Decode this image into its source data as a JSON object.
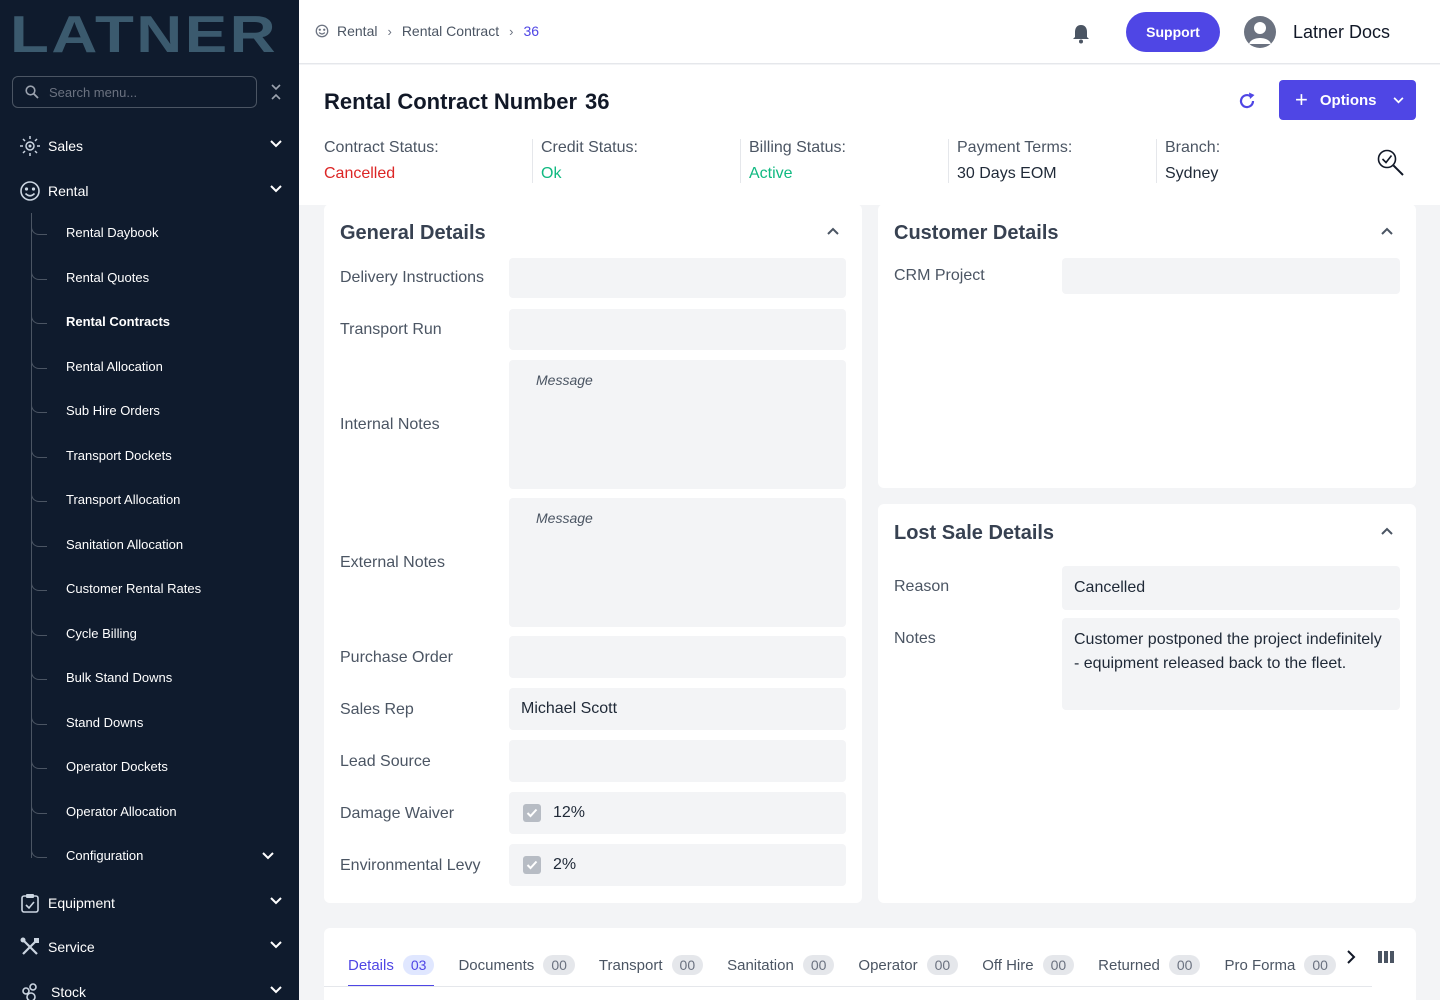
{
  "brand": {
    "logo_text": "LATNER"
  },
  "search": {
    "placeholder": "Search menu..."
  },
  "sidebar": {
    "top_items": [
      {
        "label": "Sales",
        "icon": "sales-icon"
      },
      {
        "label": "Rental",
        "icon": "rental-icon"
      },
      {
        "label": "Equipment",
        "icon": "equipment-icon"
      },
      {
        "label": "Service",
        "icon": "service-icon"
      },
      {
        "label": "Stock",
        "icon": "stock-icon"
      }
    ],
    "rental_sub_items": [
      "Rental Daybook",
      "Rental Quotes",
      "Rental Contracts",
      "Rental Allocation",
      "Sub Hire Orders",
      "Transport Dockets",
      "Transport Allocation",
      "Sanitation Allocation",
      "Customer Rental Rates",
      "Cycle Billing",
      "Bulk Stand Downs",
      "Stand Downs",
      "Operator Dockets",
      "Operator Allocation",
      "Configuration"
    ],
    "active_sub_item": "Rental Contracts"
  },
  "breadcrumb": [
    "Rental",
    "Rental Contract",
    "36"
  ],
  "topbar": {
    "support_label": "Support",
    "user_name": "Latner Docs"
  },
  "header": {
    "title_label": "Rental Contract Number",
    "title_number": "36",
    "options_label": "Options",
    "statuses": [
      {
        "label": "Contract Status:",
        "value": "Cancelled"
      },
      {
        "label": "Credit Status:",
        "value": "Ok"
      },
      {
        "label": "Billing Status:",
        "value": "Active"
      },
      {
        "label": "Payment Terms:",
        "value": "30 Days EOM"
      },
      {
        "label": "Branch:",
        "value": "Sydney"
      }
    ]
  },
  "general_details": {
    "title": "General Details",
    "fields": {
      "delivery_instructions": {
        "label": "Delivery Instructions",
        "value": ""
      },
      "transport_run": {
        "label": "Transport Run",
        "value": ""
      },
      "internal_notes": {
        "label": "Internal Notes",
        "placeholder": "Message"
      },
      "external_notes": {
        "label": "External Notes",
        "placeholder": "Message"
      },
      "purchase_order": {
        "label": "Purchase Order",
        "value": ""
      },
      "sales_rep": {
        "label": "Sales Rep",
        "value": "Michael Scott"
      },
      "lead_source": {
        "label": "Lead Source",
        "value": ""
      },
      "damage_waiver": {
        "label": "Damage Waiver",
        "value": "12%",
        "checked": true
      },
      "environmental_levy": {
        "label": "Environmental Levy",
        "value": "2%",
        "checked": true
      }
    }
  },
  "customer_details": {
    "title": "Customer Details",
    "crm_project": {
      "label": "CRM Project",
      "value": ""
    }
  },
  "lost_sale_details": {
    "title": "Lost Sale Details",
    "reason": {
      "label": "Reason",
      "value": "Cancelled"
    },
    "notes": {
      "label": "Notes",
      "value": "Customer postponed the project indefinitely - equipment released back to the fleet."
    }
  },
  "tabs": [
    {
      "label": "Details",
      "count": "03"
    },
    {
      "label": "Documents",
      "count": "00"
    },
    {
      "label": "Transport",
      "count": "00"
    },
    {
      "label": "Sanitation",
      "count": "00"
    },
    {
      "label": "Operator",
      "count": "00"
    },
    {
      "label": "Off Hire",
      "count": "00"
    },
    {
      "label": "Returned",
      "count": "00"
    },
    {
      "label": "Pro Forma",
      "count": "00"
    }
  ],
  "colors": {
    "sidebar_bg": "#0f1b2d",
    "accent": "#4f46e5",
    "status_red": "#dc2626",
    "status_green": "#10b981"
  }
}
